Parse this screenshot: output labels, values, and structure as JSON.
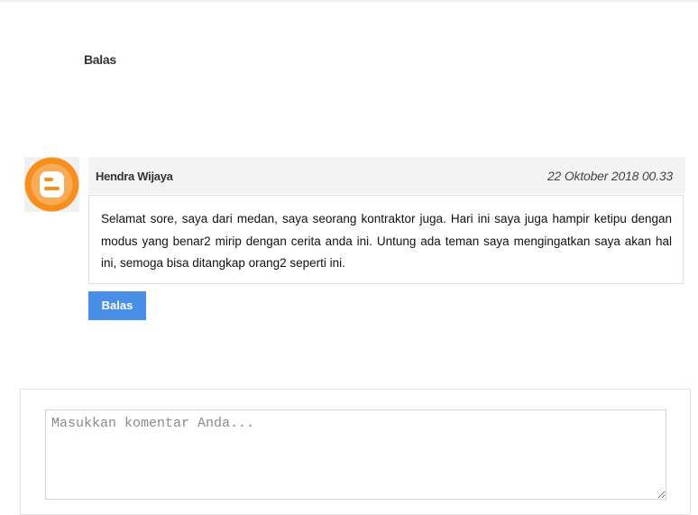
{
  "thread": {
    "reply_link_label": "Balas"
  },
  "comment": {
    "author": "Hendra Wijaya",
    "timestamp": "22 Oktober 2018 00.33",
    "text": "Selamat sore, saya dari medan, saya seorang kontraktor juga. Hari ini saya juga hampir ketipu dengan modus yang benar2 mirip dengan cerita anda ini. Untung ada teman saya mengingatkan saya akan hal ini, semoga bisa ditangkap orang2 seperti ini.",
    "avatar_icon": "blogger-icon",
    "reply_button_label": "Balas"
  },
  "comment_form": {
    "placeholder": "Masukkan komentar Anda...",
    "value": ""
  },
  "colors": {
    "accent": "#4a8fe7",
    "avatar_orange": "#f78f1e"
  }
}
